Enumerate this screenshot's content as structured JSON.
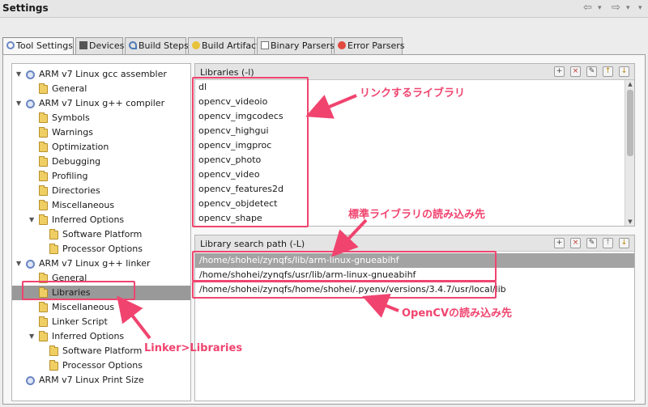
{
  "window": {
    "title": "Settings"
  },
  "nav": {
    "back": "⇦",
    "forward": "⇨",
    "dropdown": "▾",
    "menu": "▾"
  },
  "tabs": [
    {
      "label": "Tool Settings",
      "icon": "tool-settings-icon",
      "active": true
    },
    {
      "label": "Devices",
      "icon": "devices-icon"
    },
    {
      "label": "Build Steps",
      "icon": "build-steps-icon"
    },
    {
      "label": "Build Artifact",
      "icon": "build-artifact-icon"
    },
    {
      "label": "Binary Parsers",
      "icon": "binary-parsers-icon"
    },
    {
      "label": "Error Parsers",
      "icon": "error-parsers-icon"
    }
  ],
  "tree": [
    {
      "label": "ARM v7 Linux gcc assembler",
      "level": 0,
      "expanded": true,
      "icon": "gear-icon"
    },
    {
      "label": "General",
      "level": 1,
      "icon": "folder-icon"
    },
    {
      "label": "ARM v7 Linux g++ compiler",
      "level": 0,
      "expanded": true,
      "icon": "gear-icon"
    },
    {
      "label": "Symbols",
      "level": 1,
      "icon": "folder-icon"
    },
    {
      "label": "Warnings",
      "level": 1,
      "icon": "folder-icon"
    },
    {
      "label": "Optimization",
      "level": 1,
      "icon": "folder-icon"
    },
    {
      "label": "Debugging",
      "level": 1,
      "icon": "folder-icon"
    },
    {
      "label": "Profiling",
      "level": 1,
      "icon": "folder-icon"
    },
    {
      "label": "Directories",
      "level": 1,
      "icon": "folder-icon"
    },
    {
      "label": "Miscellaneous",
      "level": 1,
      "icon": "folder-icon"
    },
    {
      "label": "Inferred Options",
      "level": 1,
      "expanded": true,
      "icon": "folder-icon"
    },
    {
      "label": "Software Platform",
      "level": 2,
      "icon": "folder-icon"
    },
    {
      "label": "Processor Options",
      "level": 2,
      "icon": "folder-icon"
    },
    {
      "label": "ARM v7 Linux g++ linker",
      "level": 0,
      "expanded": true,
      "icon": "gear-icon"
    },
    {
      "label": "General",
      "level": 1,
      "icon": "folder-icon"
    },
    {
      "label": "Libraries",
      "level": 1,
      "icon": "folder-icon",
      "selected": true
    },
    {
      "label": "Miscellaneous",
      "level": 1,
      "icon": "folder-icon"
    },
    {
      "label": "Linker Script",
      "level": 1,
      "icon": "folder-icon"
    },
    {
      "label": "Inferred Options",
      "level": 1,
      "expanded": true,
      "icon": "folder-icon"
    },
    {
      "label": "Software Platform",
      "level": 2,
      "icon": "folder-icon"
    },
    {
      "label": "Processor Options",
      "level": 2,
      "icon": "folder-icon"
    },
    {
      "label": "ARM v7 Linux Print Size",
      "level": 0,
      "icon": "gear-icon"
    }
  ],
  "libraries": {
    "title": "Libraries (-l)",
    "items": [
      "dl",
      "opencv_videoio",
      "opencv_imgcodecs",
      "opencv_highgui",
      "opencv_imgproc",
      "opencv_photo",
      "opencv_video",
      "opencv_features2d",
      "opencv_objdetect",
      "opencv_shape"
    ]
  },
  "library_paths": {
    "title": "Library search path (-L)",
    "items": [
      "/home/shohei/zynqfs/lib/arm-linux-gnueabihf",
      "/home/shohei/zynqfs/usr/lib/arm-linux-gnueabihf",
      "/home/shohei/zynqfs/home/shohei/.pyenv/versions/3.4.7/usr/local/lib"
    ]
  },
  "toolbar_buttons": [
    {
      "icon": "add-icon",
      "glyph": "+"
    },
    {
      "icon": "delete-icon",
      "glyph": "×"
    },
    {
      "icon": "edit-icon",
      "glyph": "✎"
    },
    {
      "icon": "move-up-icon",
      "glyph": "↑"
    },
    {
      "icon": "move-down-icon",
      "glyph": "↓"
    }
  ],
  "annotations": {
    "link_libs": "リンクするライブラリ",
    "std_lib_path": "標準ライブラリの読み込み先",
    "opencv_path": "OpenCVの読み込み先",
    "linker_libs": "Linker>Libraries"
  },
  "colors": {
    "highlight": "#f0446f",
    "selection": "#999999"
  }
}
